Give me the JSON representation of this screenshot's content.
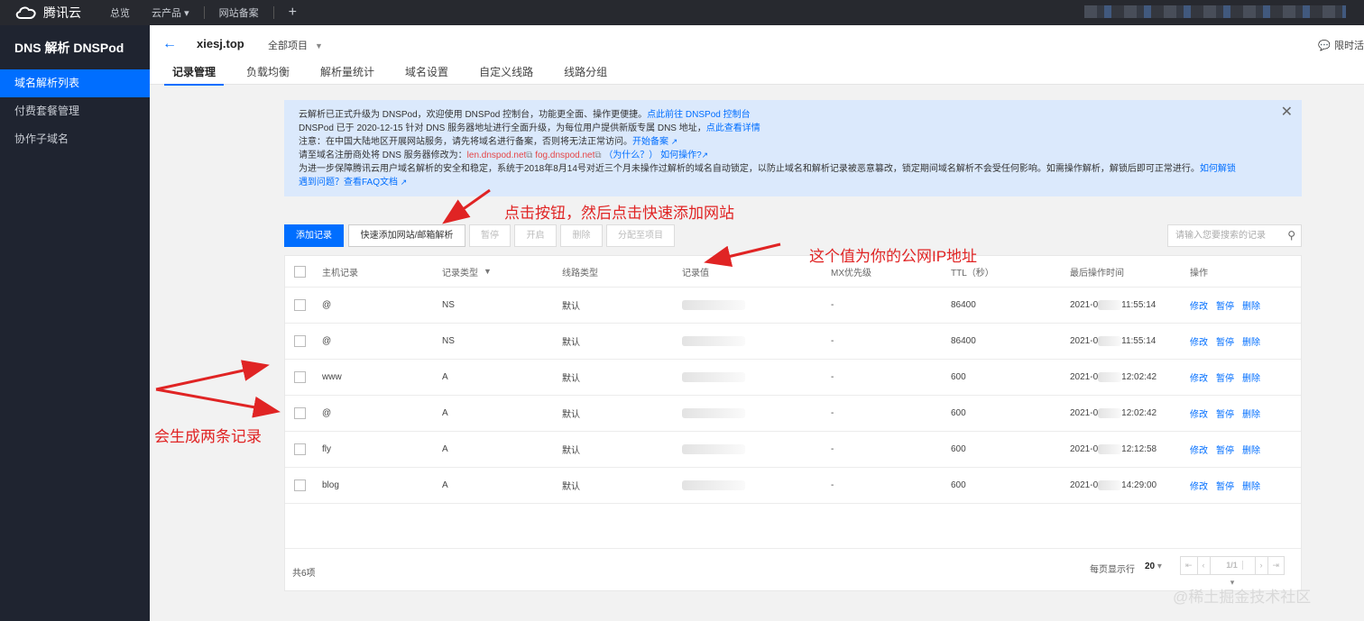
{
  "topbar": {
    "logo_text": "腾讯云",
    "nav": [
      "总览",
      "云产品",
      "网站备案"
    ],
    "plus": "+"
  },
  "sidebar": {
    "title": "DNS 解析 DNSPod",
    "items": [
      {
        "label": "域名解析列表",
        "active": true
      },
      {
        "label": "付费套餐管理",
        "active": false
      },
      {
        "label": "协作子域名",
        "active": false
      }
    ]
  },
  "header": {
    "back_icon": "arrow-left-icon",
    "domain": "xiesj.top",
    "project": "全部项目",
    "limited": "限时活",
    "tabs": [
      "记录管理",
      "负载均衡",
      "解析量统计",
      "域名设置",
      "自定义线路",
      "线路分组"
    ]
  },
  "notice": {
    "line1": "云解析已正式升级为 DNSPod，欢迎使用 DNSPod 控制台，功能更全面、操作更便捷。",
    "line1_link": "点此前往 DNSPod 控制台",
    "line2": "DNSPod 已于 2020-12-15 针对 DNS 服务器地址进行全面升级，为每位用户提供新版专属 DNS 地址，",
    "line2_link": "点此查看详情",
    "line3": "注意：在中国大陆地区开展网站服务，请先将域名进行备案，否则将无法正常访问。",
    "line3_link": "开始备案",
    "line4": "请至域名注册商处将 DNS 服务器修改为：",
    "ns1": "len.dnspod.net",
    "ns2": "fog.dnspod.net",
    "why": "（为什么？）",
    "how": "如何操作?",
    "line5": "为进一步保障腾讯云用户域名解析的安全和稳定，系统于2018年8月14号对近三个月未操作过解析的域名自动锁定，以防止域名和解析记录被恶意篡改，锁定期间域名解析不会受任何影响。如需操作解析，解锁后即可正常进行。",
    "line5_link": "如何解锁",
    "line6_link": "遇到问题？查看FAQ文档"
  },
  "toolbar": {
    "add": "添加记录",
    "quick_add": "快速添加网站/邮箱解析",
    "pause": "暂停",
    "enable": "开启",
    "delete": "删除",
    "assign": "分配至项目",
    "search_placeholder": "请输入您要搜索的记录"
  },
  "table": {
    "columns": [
      "主机记录",
      "记录类型",
      "线路类型",
      "记录值",
      "MX优先级",
      "TTL（秒）",
      "最后操作时间",
      "操作"
    ],
    "rows": [
      {
        "host": "@",
        "type": "NS",
        "line": "默认",
        "mx": "-",
        "ttl": "86400",
        "date": "2021-0",
        "time": "11:55:14"
      },
      {
        "host": "@",
        "type": "NS",
        "line": "默认",
        "mx": "-",
        "ttl": "86400",
        "date": "2021-0",
        "time": "11:55:14"
      },
      {
        "host": "www",
        "type": "A",
        "line": "默认",
        "mx": "-",
        "ttl": "600",
        "date": "2021-0",
        "time": "12:02:42"
      },
      {
        "host": "@",
        "type": "A",
        "line": "默认",
        "mx": "-",
        "ttl": "600",
        "date": "2021-0",
        "time": "12:02:42"
      },
      {
        "host": "fly",
        "type": "A",
        "line": "默认",
        "mx": "-",
        "ttl": "600",
        "date": "2021-0",
        "time": "12:12:58"
      },
      {
        "host": "blog",
        "type": "A",
        "line": "默认",
        "mx": "-",
        "ttl": "600",
        "date": "2021-0",
        "time": "14:29:00"
      }
    ],
    "ops": [
      "修改",
      "暂停",
      "删除"
    ],
    "total": "共6项",
    "page_size_label": "每页显示行",
    "page_size": "20",
    "page": "1/1"
  },
  "annotations": {
    "click_tip": "点击按钮，然后点击快速添加网站",
    "ip_tip": "这个值为你的公网IP地址",
    "two_records": "会生成两条记录"
  },
  "watermark": "@稀土掘金技术社区",
  "colors": {
    "accent": "#006eff",
    "annotation": "#e02424",
    "sidebar_bg": "#1f2430"
  }
}
